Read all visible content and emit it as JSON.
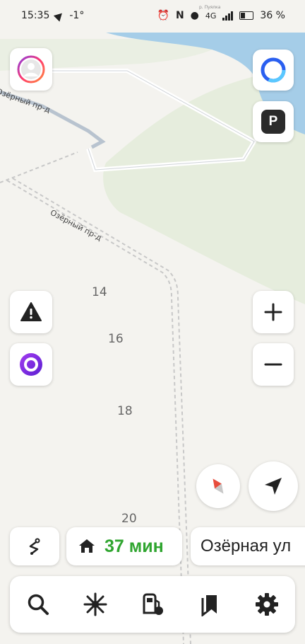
{
  "status_bar": {
    "time": "15:35",
    "temperature": "-1°",
    "network": "4G",
    "battery": "36 %"
  },
  "map": {
    "street_name_upper": "Озёрный пр-д",
    "street_name_lower": "Озёрный пр-д",
    "water_label": "р. Пуялка",
    "house_numbers": [
      "14",
      "16",
      "18",
      "20"
    ],
    "colors": {
      "water": "#a5cde8",
      "park": "#e6eddd",
      "land": "#f4f3ef"
    }
  },
  "route": {
    "duration": "37 мин",
    "destination": "Озёрная ул",
    "accent_color": "#2fa52f"
  },
  "icons": {
    "profile": "avatar-icon",
    "alice_top": "alice-ring-icon",
    "parking": "parking-icon",
    "road_events": "warning-icon",
    "alice": "alice-icon",
    "zoom_in": "plus-icon",
    "zoom_out": "minus-icon",
    "compass": "compass-icon",
    "locate": "navigation-arrow-icon",
    "route_overview": "route-icon",
    "home": "home-icon",
    "search": "search-icon",
    "discovery": "sparkle-icon",
    "fuel": "fuel-icon",
    "bookmarks": "bookmarks-icon",
    "settings": "gear-icon"
  },
  "parking_label": "P"
}
